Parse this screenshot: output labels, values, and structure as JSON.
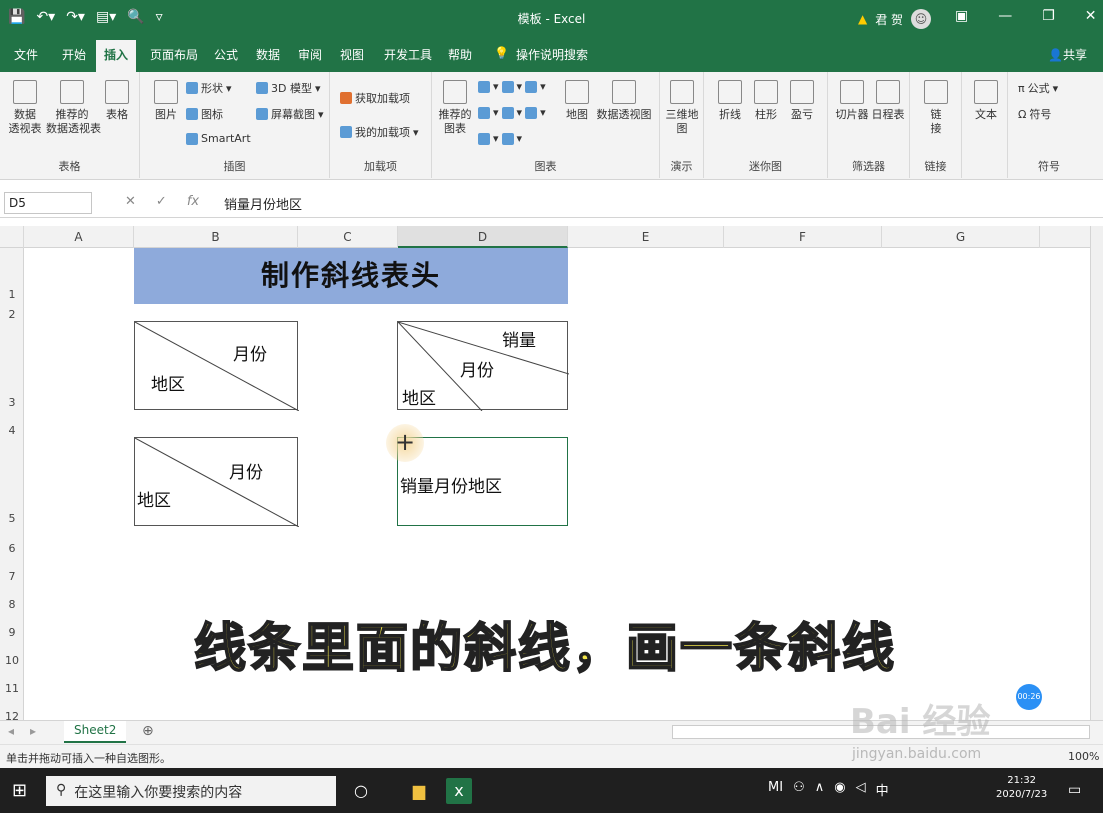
{
  "window": {
    "title": "模板 - Excel",
    "user_name": "君 贺",
    "qat_icons": [
      "save-icon",
      "undo-icon",
      "redo-icon",
      "form-icon",
      "print-preview-icon",
      "customize-icon"
    ]
  },
  "tabs": [
    "文件",
    "开始",
    "插入",
    "页面布局",
    "公式",
    "数据",
    "审阅",
    "视图",
    "开发工具",
    "帮助"
  ],
  "active_tab": "插入",
  "tell_me": "操作说明搜索",
  "share": "共享",
  "ribbon": {
    "tables": {
      "label": "表格",
      "pivot": "数据\n透视表",
      "recommended_pivot": "推荐的\n数据透视表",
      "table": "表格"
    },
    "illustrations": {
      "label": "插图",
      "picture": "图片",
      "shapes": "形状",
      "icons": "图标",
      "smartart": "SmartArt",
      "model3d": "3D 模型",
      "screenshot": "屏幕截图"
    },
    "addins": {
      "label": "加载项",
      "get": "获取加载项",
      "my": "我的加载项"
    },
    "charts": {
      "label": "图表",
      "recommended": "推荐的\n图表",
      "map": "地图",
      "pivot_chart": "数据透视图"
    },
    "tours": {
      "label": "演示",
      "map3d": "三维地\n图"
    },
    "sparklines": {
      "label": "迷你图",
      "line": "折线",
      "column": "柱形",
      "winloss": "盈亏"
    },
    "filters": {
      "label": "筛选器",
      "slicer": "切片器",
      "timeline": "日程表"
    },
    "links": {
      "label": "链接",
      "link": "链\n接"
    },
    "text": {
      "label": "",
      "text": "文本"
    },
    "symbols": {
      "label": "符号",
      "equation": "公式",
      "symbol": "符号"
    }
  },
  "formula_bar": {
    "name_box": "D5",
    "value": "销量月份地区",
    "fx": "fx"
  },
  "columns": [
    "A",
    "B",
    "C",
    "D",
    "E",
    "F",
    "G"
  ],
  "rows": [
    "1",
    "2",
    "3",
    "4",
    "5",
    "6",
    "7",
    "8",
    "9",
    "10",
    "11",
    "12"
  ],
  "sheet": {
    "title": "制作斜线表头",
    "box1": {
      "top": "月份",
      "bottom": "地区"
    },
    "box2": {
      "top": "销量",
      "mid": "月份",
      "bottom": "地区"
    },
    "box3": {
      "top": "月份",
      "bottom": "地区"
    },
    "box4": {
      "text": "销量月份地区"
    }
  },
  "caption": "线条里面的斜线，画一条斜线",
  "timer": "00:26",
  "sheet_tab": "Sheet2",
  "status": "单击并拖动可插入一种自选图形。",
  "zoom": "100%",
  "watermark": "Bai 经验",
  "watermark_url": "jingyan.baidu.com",
  "taskbar": {
    "search": "在这里输入你要搜索的内容",
    "time": "21:32",
    "date": "2020/7/23",
    "ime": "中",
    "tray_logo": "MI"
  }
}
